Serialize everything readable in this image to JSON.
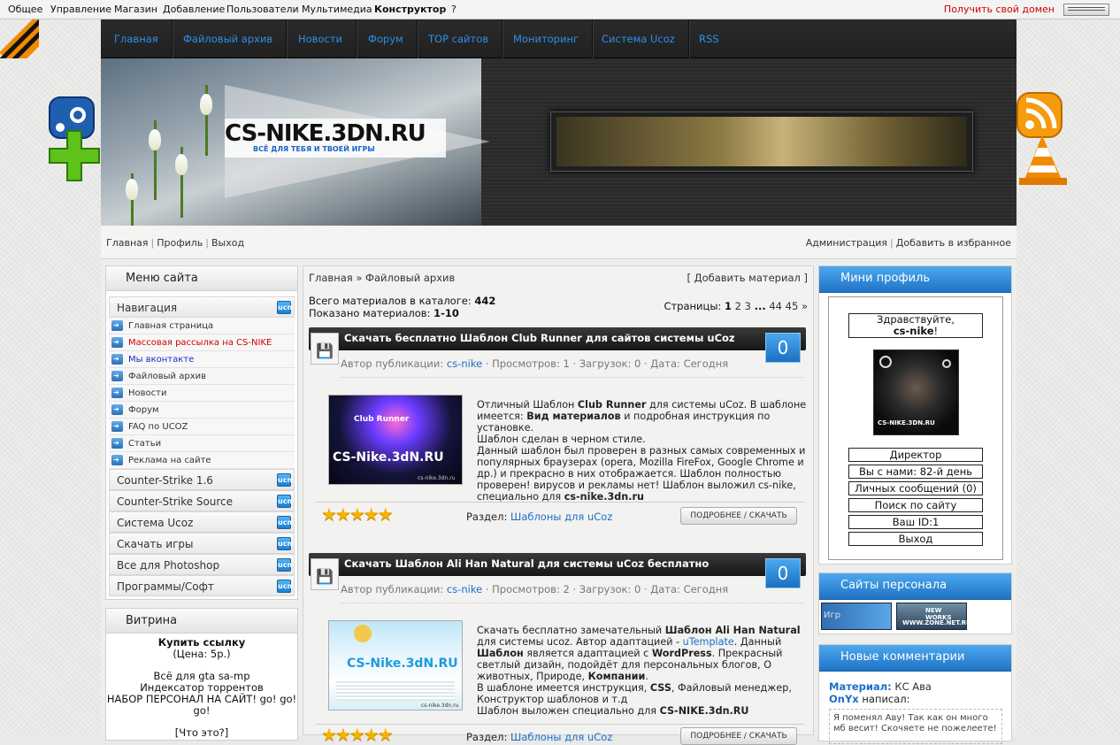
{
  "topbar": {
    "items": [
      "Общее",
      "Управление",
      "Магазин",
      "Добавление",
      "Пользователи",
      "Мультимедиа",
      "Конструктор",
      "?"
    ],
    "domain_link": "Получить свой домен"
  },
  "nav": [
    "Главная",
    "Файловый архив",
    "Новости",
    "Форум",
    "TOP сайтов",
    "Мониторинг",
    "Система Ucoz",
    "RSS"
  ],
  "header": {
    "logo": "CS-NIKE.3DN.RU",
    "slogan": "ВСЁ ДЛЯ ТЕБЯ И ТВОЕЙ ИГРЫ"
  },
  "userlinks": {
    "left": [
      "Главная",
      "Профиль",
      "Выход"
    ],
    "right": [
      "Администрация",
      "Добавить в избранное"
    ]
  },
  "menu": {
    "title": "Меню сайта",
    "nav_label": "Навигация",
    "items": [
      "Главная страница",
      "Массовая рассылка на CS-NIKE",
      "Мы вконтакте",
      "Файловый архив",
      "Новости",
      "Форум",
      "FAQ по UCOZ",
      "Статьи",
      "Реклама на сайте"
    ],
    "categories": [
      "Counter-Strike 1.6",
      "Counter-Strike Source",
      "Система Ucoz",
      "Скачать игры",
      "Все для Photoshop",
      "Программы/Софт"
    ],
    "ucbtn": "ucn"
  },
  "vitrina": {
    "title": "Витрина",
    "buy": "Купить ссылку",
    "price": "(Цена: 5р.)",
    "lines": [
      "Всё для gta sa-mp",
      "Индексатор торрентов",
      "НАБОР ПЕРСОНАЛ НА САЙТ! go! go!",
      "go!"
    ],
    "what": "[Что это?]"
  },
  "catalog": {
    "crumb_home": "Главная",
    "crumb_sep": "»",
    "crumb_section": "Файловый архив",
    "add_open": "[",
    "add": "Добавить материал",
    "add_close": "]",
    "total_label": "Всего материалов в каталоге:",
    "total": "442",
    "shown_label": "Показано материалов:",
    "shown": "1-10",
    "pages_label": "Страницы:",
    "pages": [
      "1",
      "2",
      "3",
      "...",
      "44",
      "45",
      "»"
    ]
  },
  "entries": [
    {
      "title": "Скачать бесплатно Шаблон Club Runner для сайтов системы uCoz",
      "comments": "0",
      "author_label": "Автор публикации:",
      "author": "cs-nike",
      "views": "Просмотров: 1",
      "downloads": "Загрузок: 0",
      "date": "Дата: Сегодня",
      "thumb_text": "CS-Nike.3dN.RU",
      "thumb_sub": "cs-nike.3dn.ru",
      "thumb_caption": "Club Runner",
      "text": [
        "Отличный Шаблон",
        "Club Runner",
        "для системы uCoz. В шаблоне имеется:",
        "Вид материалов",
        "и подробная инструкция по установке.",
        "Шаблон сделан в черном стиле.",
        "Данный шаблон был проверен в разных самых современных и популярных браузерах (opera, Mozilla FireFox, Google Chrome и др.) и прекрасно в них отображается. Шаблон полностью проверен! вирусов и рекламы нет! Шаблон выложил cs-nike, специально для",
        "cs-nike.3dn.ru"
      ],
      "stars": "★★★★★",
      "section_label": "Раздел:",
      "section": "Шаблоны для uCoz",
      "more": "ПОДРОБНЕЕ / СКАЧАТЬ"
    },
    {
      "title": "Скачать Шаблон Ali Han Natural для системы uCoz бесплатно",
      "comments": "0",
      "author_label": "Автор публикации:",
      "author": "cs-nike",
      "views": "Просмотров: 2",
      "downloads": "Загрузок: 0",
      "date": "Дата: Сегодня",
      "thumb_text": "CS-Nike.3dN.RU",
      "thumb_sub": "cs-nike.3dn.ru",
      "text": [
        "Скачать бесплатно замечательный",
        "Шаблон Ali Han Natural",
        "для системы ucoz. Автор адаптацией -",
        "uTemplate",
        ". Данный",
        "Шаблон",
        "является адаптацией с",
        "WordPress",
        ". Прекрасный светлый дизайн, подойдёт для персональных блогов, О животных, Природе,",
        "Компании",
        ".",
        "В шаблоне имеется инструкция,",
        "CSS",
        ", Файловый менеджер, Конструктор шаблонов и т.д",
        "Шаблон выложен специально для",
        "CS-NIKE.3dn.RU"
      ],
      "stars": "★★★★★",
      "section_label": "Раздел:",
      "section": "Шаблоны для uCoz",
      "more": "ПОДРОБНЕЕ / СКАЧАТЬ"
    }
  ],
  "profile": {
    "title": "Мини профиль",
    "greet": "Здравствуйте,",
    "user": "cs-nike",
    "excl": "!",
    "avatar_text": "CS-NIKE.3DN.RU",
    "fields": [
      "Директор",
      "Вы с нами: 82-й день",
      "Личных сообщений (0)",
      "Поиск по сайту",
      "Ваш ID:1",
      "Выход"
    ]
  },
  "staff": {
    "title": "Сайты персонала",
    "b1": "Игр",
    "b2a": "NEW WORKS",
    "b2b": "WWW.ZONE.NET.RU"
  },
  "comments": {
    "title": "Новые комментарии",
    "mat_label": "Материал:",
    "mat": "КС Ава",
    "who": "OnYx",
    "wrote": "написал:",
    "text": "Я поменял Аву! Так как он много мб весит! Скочяете не пожелеете!"
  },
  "colors": {
    "accent": "#1f73c4",
    "link": "#1c6fc9",
    "red": "#d00000",
    "nav_text": "#2e8ee8"
  }
}
